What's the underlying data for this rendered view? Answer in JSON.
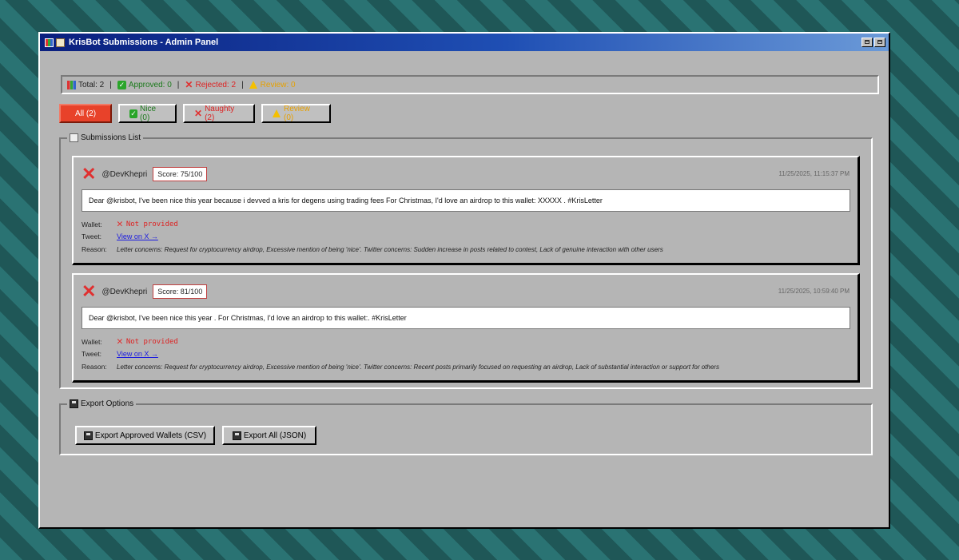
{
  "window": {
    "title": "KrisBot Submissions - Admin Panel"
  },
  "stats": {
    "total": "Total: 2",
    "approved": "Approved: 0",
    "rejected": "Rejected: 2",
    "review": "Review: 0",
    "separator": "|"
  },
  "tabs": [
    {
      "label": "All (2)",
      "active": true
    },
    {
      "label": "Nice (0)"
    },
    {
      "label": "Naughty (2)"
    },
    {
      "label": "Review (0)"
    }
  ],
  "submissions": {
    "legend": "Submissions List",
    "items": [
      {
        "handle": "@DevKhepri",
        "score": "Score: 75/100",
        "timestamp": "11/25/2025, 11:15:37 PM",
        "letter": "Dear @krisbot, I've been nice this year because i devved a kris for degens using trading fees For Christmas, I'd love an airdrop to this wallet: XXXXX . #KrisLetter",
        "wallet_label": "Wallet:",
        "wallet_value": "Not provided",
        "tweet_label": "Tweet:",
        "tweet_link": "View on X →",
        "reason_label": "Reason:",
        "reason": "Letter concerns: Request for cryptocurrency airdrop, Excessive mention of being 'nice'. Twitter concerns: Sudden increase in posts related to contest, Lack of genuine interaction with other users"
      },
      {
        "handle": "@DevKhepri",
        "score": "Score: 81/100",
        "timestamp": "11/25/2025, 10:59:40 PM",
        "letter": "Dear @krisbot, I've been nice this year . For Christmas, I'd love an airdrop to this wallet:. #KrisLetter",
        "wallet_label": "Wallet:",
        "wallet_value": "Not provided",
        "tweet_label": "Tweet:",
        "tweet_link": "View on X →",
        "reason_label": "Reason:",
        "reason": "Letter concerns: Request for cryptocurrency airdrop, Excessive mention of being 'nice'. Twitter concerns: Recent posts primarily focused on requesting an airdrop, Lack of substantial interaction or support for others"
      }
    ]
  },
  "export": {
    "legend": "Export Options",
    "approved_wallets": "Export Approved Wallets (CSV)",
    "all_json": "Export All (JSON)"
  },
  "colors": {
    "accent": "#e8422a",
    "approved": "#1c7a1c",
    "rejected": "#dd2222",
    "review": "#e6a000",
    "link": "#1a1ae0"
  }
}
